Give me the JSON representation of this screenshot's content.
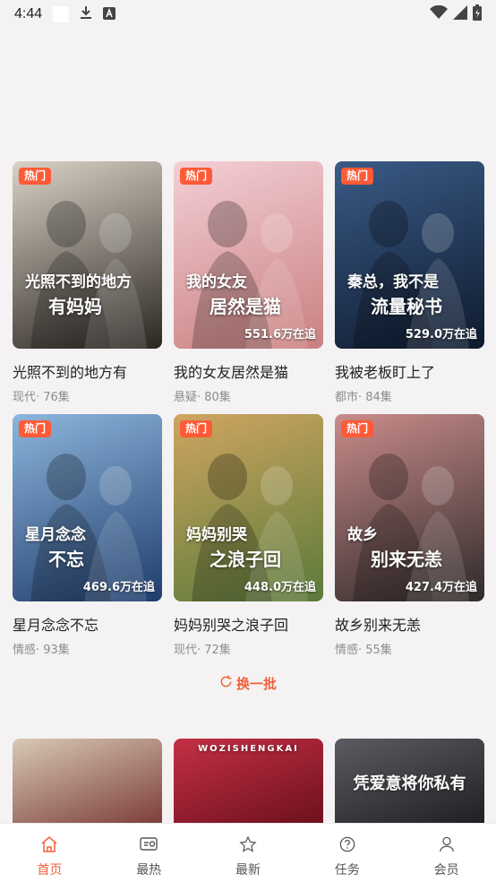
{
  "status_bar": {
    "time": "4:44"
  },
  "badges": {
    "hot": "热门"
  },
  "cards": [
    {
      "title": "光照不到的地方有",
      "meta": "现代· 76集",
      "hot": true,
      "follow": "",
      "poster_text_1": "光照不到的地方",
      "poster_text_2": "有妈妈",
      "colors": [
        "#d8d2c6",
        "#2c2622"
      ]
    },
    {
      "title": "我的女友居然是猫",
      "meta": "悬疑· 80集",
      "hot": true,
      "follow": "551.6万在追",
      "poster_text_1": "我的女友",
      "poster_text_2": "居然是猫",
      "colors": [
        "#f3cfd6",
        "#c9807f"
      ]
    },
    {
      "title": "我被老板盯上了",
      "meta": "都市· 84集",
      "hot": true,
      "follow": "529.0万在追",
      "poster_text_1": "秦总，我不是",
      "poster_text_2": "流量秘书",
      "colors": [
        "#3a5b86",
        "#0e1a2e"
      ]
    },
    {
      "title": "星月念念不忘",
      "meta": "情感· 93集",
      "hot": true,
      "follow": "469.6万在追",
      "poster_text_1": "星月念念",
      "poster_text_2": "不忘",
      "colors": [
        "#8db6dc",
        "#1f3d6c"
      ]
    },
    {
      "title": "妈妈别哭之浪子回",
      "meta": "现代· 72集",
      "hot": true,
      "follow": "448.0万在追",
      "poster_text_1": "妈妈别哭",
      "poster_text_2": "之浪子回",
      "colors": [
        "#cfa560",
        "#5a7a3a"
      ]
    },
    {
      "title": "故乡别来无恙",
      "meta": "情感· 55集",
      "hot": true,
      "follow": "427.4万在追",
      "poster_text_1": "故乡",
      "poster_text_2": "别来无恙",
      "colors": [
        "#c98c8a",
        "#2f2a2a"
      ]
    }
  ],
  "partial_cards": [
    {
      "text": "",
      "colors": [
        "#d8c9b6",
        "#7a3a36"
      ]
    },
    {
      "text": "WOZISHENGKAI",
      "colors": [
        "#c43045",
        "#6a0f1c"
      ]
    },
    {
      "text": "凭爱意将你私有",
      "colors": [
        "#5b5b61",
        "#1e1e22"
      ]
    }
  ],
  "refresh": {
    "label": "换一批"
  },
  "nav": [
    {
      "label": "首页",
      "icon": "home-icon",
      "active": true
    },
    {
      "label": "最热",
      "icon": "hot-screen-icon",
      "active": false
    },
    {
      "label": "最新",
      "icon": "star-icon",
      "active": false
    },
    {
      "label": "任务",
      "icon": "question-circle-icon",
      "active": false
    },
    {
      "label": "会员",
      "icon": "user-icon",
      "active": false
    }
  ],
  "colors": {
    "accent": "#f0623c",
    "hot_badge": "#ff5a36",
    "background": "#f4f2f2"
  }
}
